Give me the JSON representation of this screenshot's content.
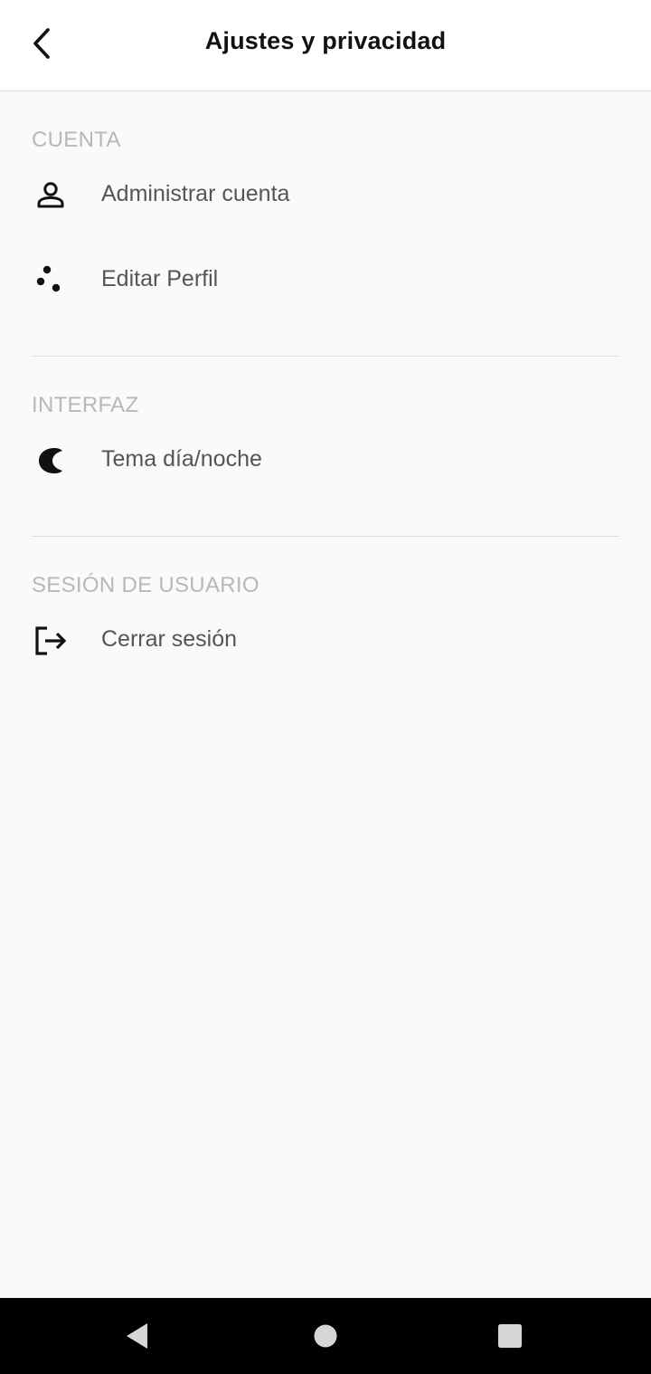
{
  "header": {
    "title": "Ajustes y privacidad",
    "back_icon": "chevron-left-icon"
  },
  "sections": [
    {
      "label": "CUENTA",
      "items": [
        {
          "label": "Administrar cuenta",
          "icon": "person-icon"
        },
        {
          "label": "Editar Perfil",
          "icon": "dots-icon"
        }
      ]
    },
    {
      "label": "INTERFAZ",
      "items": [
        {
          "label": "Tema día/noche",
          "icon": "moon-icon"
        }
      ]
    },
    {
      "label": "SESIÓN DE USUARIO",
      "items": [
        {
          "label": "Cerrar sesión",
          "icon": "logout-icon"
        }
      ]
    }
  ],
  "navbar": {
    "back_icon": "nav-back-icon",
    "home_icon": "nav-home-icon",
    "recents_icon": "nav-recents-icon"
  },
  "colors": {
    "background": "#fafafa",
    "header_bg": "#ffffff",
    "section_label": "#b8b8b8",
    "item_text": "#555555",
    "title_text": "#111111",
    "divider": "#dcdcdc",
    "navbar_bg": "#000000"
  }
}
